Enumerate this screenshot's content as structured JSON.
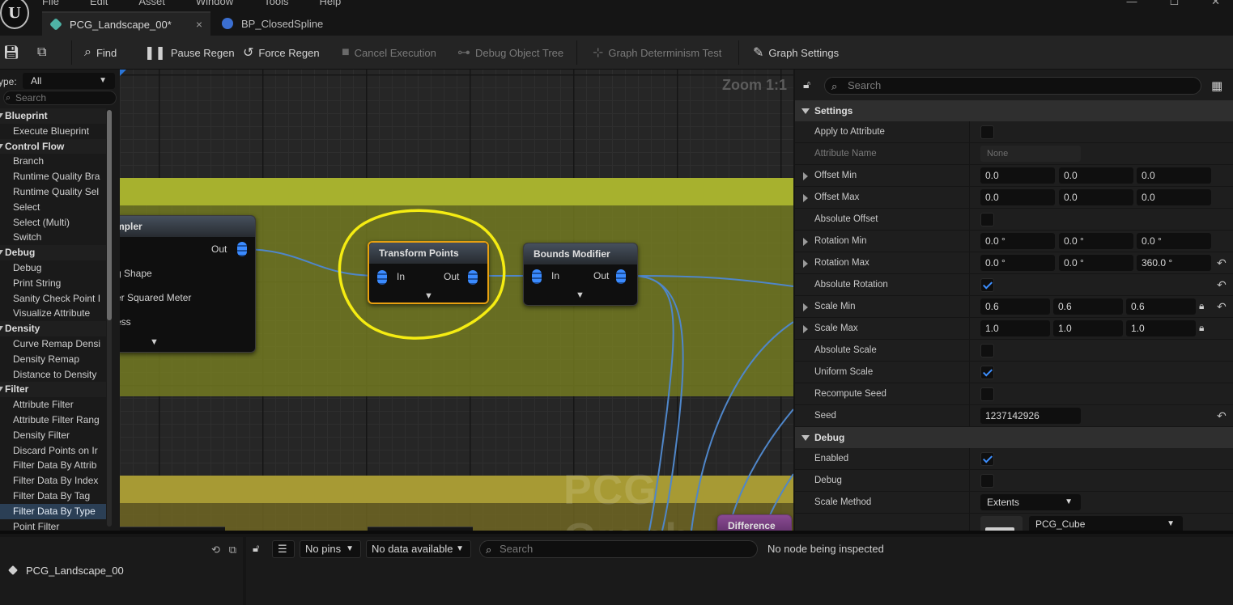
{
  "menu": [
    "File",
    "Edit",
    "Asset",
    "Window",
    "Tools",
    "Help"
  ],
  "tabs": [
    {
      "label": "PCG_Landscape_00*"
    },
    {
      "label": "BP_ClosedSpline"
    }
  ],
  "toolbar": {
    "find": "Find",
    "pause_regen": "Pause Regen",
    "force_regen": "Force Regen",
    "cancel_execution": "Cancel Execution",
    "debug_object_tree": "Debug Object Tree",
    "graph_determinism_test": "Graph Determinism Test",
    "graph_settings": "Graph Settings"
  },
  "palette": {
    "type_label": "ype:",
    "type_value": "All",
    "search_placeholder": "Search",
    "rows": [
      {
        "kind": "cat",
        "label": "Blueprint"
      },
      {
        "kind": "item",
        "label": "Execute Blueprint"
      },
      {
        "kind": "cat",
        "label": "Control Flow"
      },
      {
        "kind": "item",
        "label": "Branch"
      },
      {
        "kind": "item",
        "label": "Runtime Quality Bra"
      },
      {
        "kind": "item",
        "label": "Runtime Quality Sel"
      },
      {
        "kind": "item",
        "label": "Select"
      },
      {
        "kind": "item",
        "label": "Select (Multi)"
      },
      {
        "kind": "item",
        "label": "Switch"
      },
      {
        "kind": "cat",
        "label": "Debug"
      },
      {
        "kind": "item",
        "label": "Debug"
      },
      {
        "kind": "item",
        "label": "Print String"
      },
      {
        "kind": "item",
        "label": "Sanity Check Point I"
      },
      {
        "kind": "item",
        "label": "Visualize Attribute"
      },
      {
        "kind": "cat",
        "label": "Density"
      },
      {
        "kind": "item",
        "label": "Curve Remap Densi"
      },
      {
        "kind": "item",
        "label": "Density Remap"
      },
      {
        "kind": "item",
        "label": "Distance to Density"
      },
      {
        "kind": "cat",
        "label": "Filter"
      },
      {
        "kind": "item",
        "label": "Attribute Filter"
      },
      {
        "kind": "item",
        "label": "Attribute Filter Rang"
      },
      {
        "kind": "item",
        "label": "Density Filter"
      },
      {
        "kind": "item",
        "label": "Discard Points on Ir"
      },
      {
        "kind": "item",
        "label": "Filter Data By Attrib"
      },
      {
        "kind": "item",
        "label": "Filter Data By Index"
      },
      {
        "kind": "item",
        "label": "Filter Data By Tag"
      },
      {
        "kind": "item",
        "label": "Filter Data By Type",
        "selected": true
      },
      {
        "kind": "item",
        "label": "Point Filter"
      }
    ]
  },
  "graph": {
    "zoom": "Zoom 1:1",
    "watermark": "PCG Graph",
    "nodes": {
      "sampler": {
        "title": "mpler",
        "out": "Out",
        "line1": "g Shape",
        "line2": "er Squared Meter",
        "line3": "ess"
      },
      "transform": {
        "title": "Transform Points",
        "in": "In",
        "out": "Out"
      },
      "bounds": {
        "title": "Bounds Modifier",
        "in": "In",
        "out": "Out"
      },
      "difference": {
        "title": "Difference"
      }
    }
  },
  "details": {
    "search_placeholder": "Search",
    "sections": {
      "settings": "Settings",
      "debug": "Debug"
    },
    "props": {
      "apply_to_attribute": {
        "label": "Apply to Attribute",
        "checked": false
      },
      "attribute_name": {
        "label": "Attribute Name",
        "value": "None"
      },
      "offset_min": {
        "label": "Offset Min",
        "x": "0.0",
        "y": "0.0",
        "z": "0.0"
      },
      "offset_max": {
        "label": "Offset Max",
        "x": "0.0",
        "y": "0.0",
        "z": "0.0"
      },
      "absolute_offset": {
        "label": "Absolute Offset",
        "checked": false
      },
      "rotation_min": {
        "label": "Rotation Min",
        "x": "0.0 °",
        "y": "0.0 °",
        "z": "0.0 °"
      },
      "rotation_max": {
        "label": "Rotation Max",
        "x": "0.0 °",
        "y": "0.0 °",
        "z": "360.0 °"
      },
      "absolute_rotation": {
        "label": "Absolute Rotation",
        "checked": true
      },
      "scale_min": {
        "label": "Scale Min",
        "x": "0.6",
        "y": "0.6",
        "z": "0.6"
      },
      "scale_max": {
        "label": "Scale Max",
        "x": "1.0",
        "y": "1.0",
        "z": "1.0"
      },
      "absolute_scale": {
        "label": "Absolute Scale",
        "checked": false
      },
      "uniform_scale": {
        "label": "Uniform Scale",
        "checked": true
      },
      "recompute_seed": {
        "label": "Recompute Seed",
        "checked": false
      },
      "seed": {
        "label": "Seed",
        "value": "1237142926"
      },
      "enabled": {
        "label": "Enabled",
        "checked": true
      },
      "debug": {
        "label": "Debug",
        "checked": false
      },
      "scale_method": {
        "label": "Scale Method",
        "value": "Extents"
      },
      "debug_mesh": {
        "value": "PCG_Cube"
      }
    }
  },
  "outliner": {
    "item": "PCG_Landscape_00"
  },
  "inspector": {
    "pins": "No pins",
    "data": "No data available",
    "search_placeholder": "Search",
    "status": "No node being inspected"
  },
  "colors": {
    "accent_blue": "#3d8fff",
    "selection_orange": "#e8a010",
    "annotation_yellow": "#f5ec12",
    "comment_green": "#a7b12e"
  }
}
